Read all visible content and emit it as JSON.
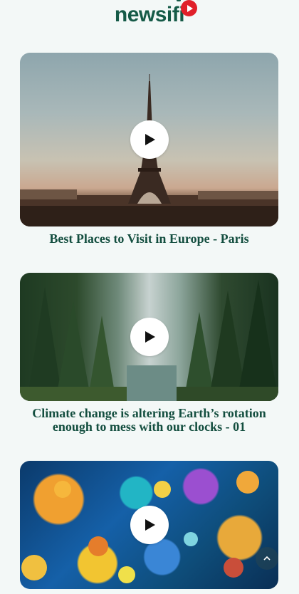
{
  "header": {
    "logo_text": "newsifi"
  },
  "videos": [
    {
      "title": "Best Places to Visit in Europe - Paris",
      "image": "eiffel-tower-scene"
    },
    {
      "title": "Climate change is altering Earth’s rotation enough to mess with our clocks - 01",
      "image": "forest-lake-scene"
    },
    {
      "title": "",
      "image": "coral-reef-scene"
    }
  ],
  "colors": {
    "brand_green": "#155a47",
    "brand_red": "#e0202a",
    "title_color": "#134e3f",
    "background": "#f3f8f7"
  },
  "icons": {
    "play": "play-icon",
    "scroll_top": "chevron-up-icon"
  }
}
